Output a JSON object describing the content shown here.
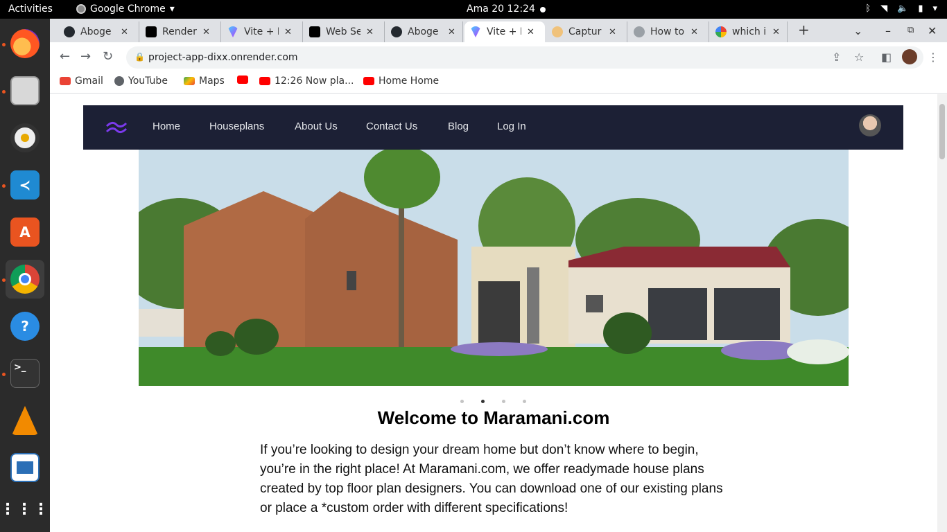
{
  "system": {
    "activities": "Activities",
    "app_name": "Google Chrome",
    "clock": "Ama 20  12:24"
  },
  "dock": {
    "items": [
      "firefox",
      "files",
      "rhythmbox",
      "vscode",
      "software-center",
      "chrome",
      "help",
      "terminal",
      "vlc",
      "libreoffice-writer",
      "show-apps"
    ]
  },
  "browser": {
    "tabs": [
      {
        "label": "Aboge",
        "favicon": "github-icon"
      },
      {
        "label": "Render",
        "favicon": "render-icon"
      },
      {
        "label": "Vite + R",
        "favicon": "vite-icon"
      },
      {
        "label": "Web Se",
        "favicon": "render-icon"
      },
      {
        "label": "Aboge",
        "favicon": "github-icon"
      },
      {
        "label": "Vite + R",
        "favicon": "vite-icon",
        "active": true
      },
      {
        "label": "Captur",
        "favicon": "capture-icon"
      },
      {
        "label": "How to",
        "favicon": "globe-icon"
      },
      {
        "label": "which i",
        "favicon": "google-icon"
      }
    ],
    "url": "project-app-dixx.onrender.com",
    "bookmarks": [
      {
        "label": "Gmail",
        "icon": "gmail-icon"
      },
      {
        "label": "YouTube",
        "icon": "globe-icon"
      },
      {
        "label": "Maps",
        "icon": "maps-icon"
      },
      {
        "label": "",
        "icon": "youtube-icon"
      },
      {
        "label": "12:26 Now pla...",
        "icon": "youtube-icon"
      },
      {
        "label": "Home Home",
        "icon": "youtube-icon"
      }
    ]
  },
  "site": {
    "nav": [
      {
        "label": "Home"
      },
      {
        "label": "Houseplans"
      },
      {
        "label": "About Us"
      },
      {
        "label": "Contact Us"
      },
      {
        "label": "Blog"
      },
      {
        "label": "Log In"
      }
    ],
    "carousel": {
      "count": 4,
      "active": 2
    },
    "welcome": "Welcome to Maramani.com",
    "intro": "If you’re looking to design your dream home but don’t know where to begin, you’re in the right place! At Maramani.com, we offer readymade house plans created by top floor plan designers. You can download one of our existing plans or place a *custom order with different specifications!"
  },
  "colors": {
    "nav_bg": "#1c2035",
    "logo": "#7c3aed"
  }
}
